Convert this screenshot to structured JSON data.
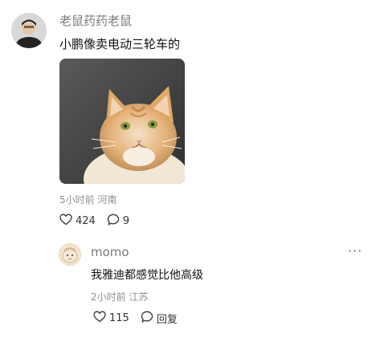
{
  "post": {
    "username": "老鼠药药老鼠",
    "text": "小鹏像卖电动三轮车的",
    "meta": "5小时前 河南",
    "likes": "424",
    "comments": "9"
  },
  "reply": {
    "username": "momo",
    "text": "我雅迪都感觉比他高级",
    "meta": "2小时前 江苏",
    "likes": "115",
    "reply_label": "回复",
    "more": "···"
  }
}
